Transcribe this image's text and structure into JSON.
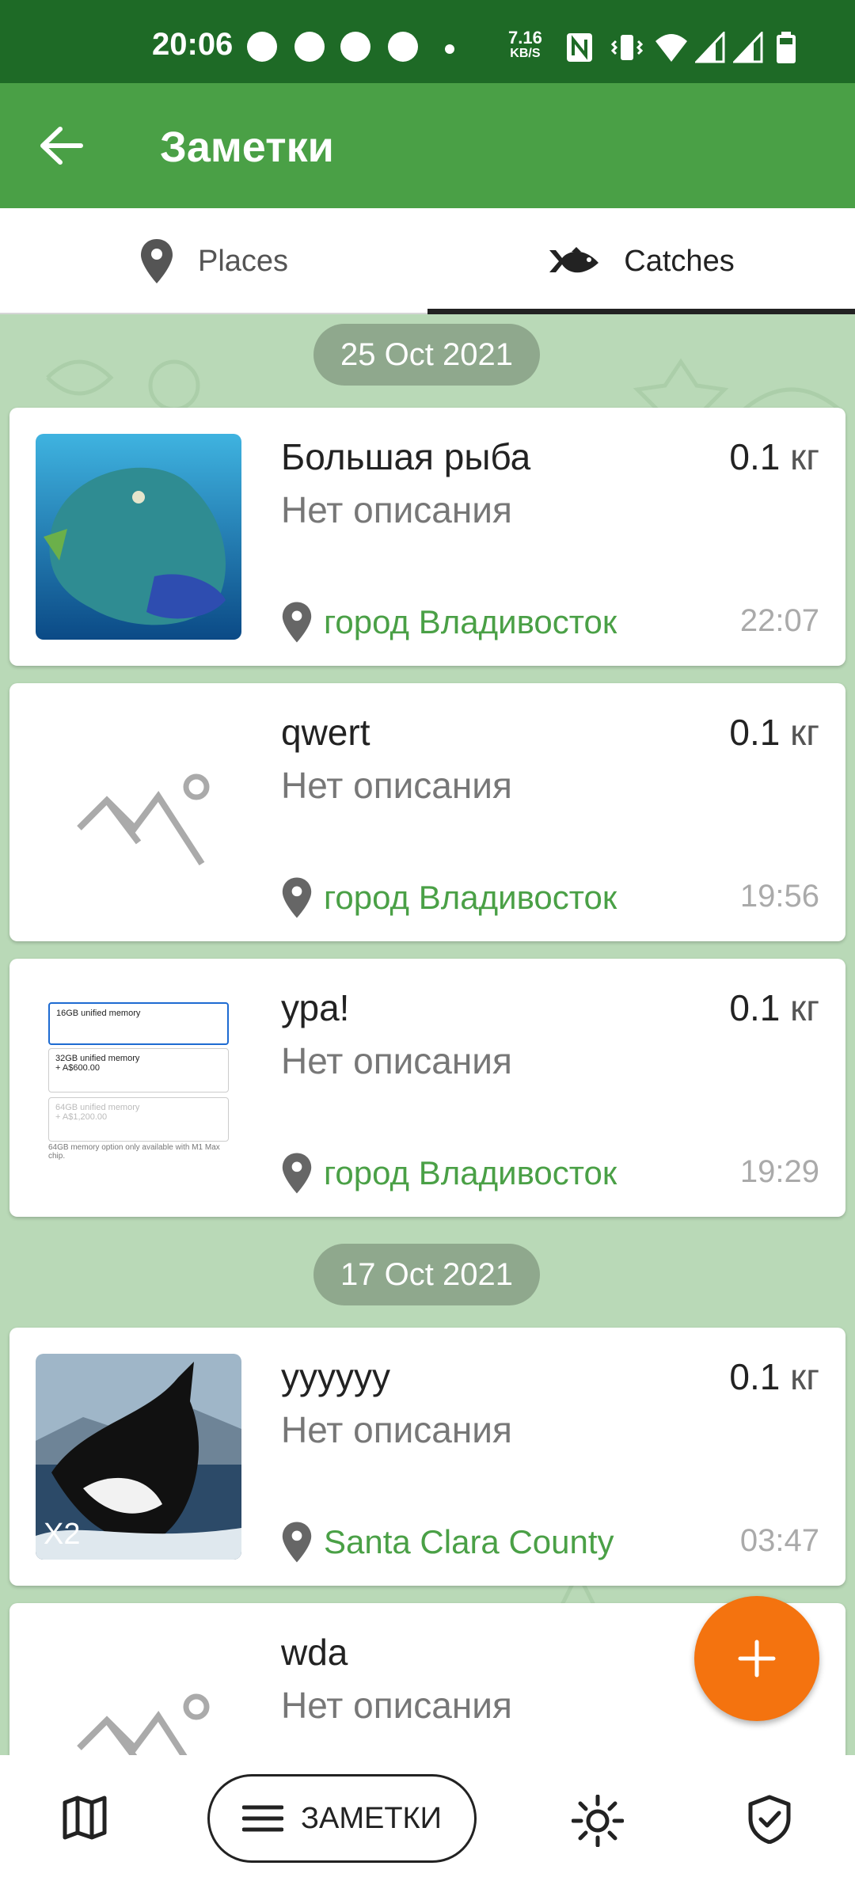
{
  "status_bar": {
    "time": "20:06",
    "net_speed": "7.16",
    "net_unit": "KB/S",
    "icons": [
      "whatsapp-icon",
      "telegram-icon",
      "telegram-icon",
      "telegram-icon",
      "dot",
      "nfc-icon",
      "vibrate-icon",
      "wifi-icon",
      "signal-icon",
      "signal-icon",
      "battery-icon"
    ]
  },
  "app_bar": {
    "title": "Заметки",
    "back_icon": "arrow-left-icon"
  },
  "tabs": [
    {
      "label": "Places",
      "icon": "map-pin-icon",
      "selected": false
    },
    {
      "label": "Catches",
      "icon": "fish-icon",
      "selected": true
    }
  ],
  "sections": [
    {
      "date": "25 Oct 2021",
      "items": [
        {
          "name": "Большая рыба",
          "weight": "0.1",
          "unit": "кг",
          "description": "Нет описания",
          "place": "город Владивосток",
          "time": "22:07",
          "image": "fish-photo"
        },
        {
          "name": "qwert",
          "weight": "0.1",
          "unit": "кг",
          "description": "Нет описания",
          "place": "город Владивосток",
          "time": "19:56",
          "image": "placeholder"
        },
        {
          "name": "ура!",
          "weight": "0.1",
          "unit": "кг",
          "description": "Нет описания",
          "place": "город Владивосток",
          "time": "19:29",
          "image": "screenshot"
        }
      ]
    },
    {
      "date": "17 Oct 2021",
      "items": [
        {
          "name": "уууууу",
          "weight": "0.1",
          "unit": "кг",
          "description": "Нет описания",
          "place": "Santa Clara County",
          "time": "03:47",
          "image": "orca-photo",
          "badge": "X2"
        },
        {
          "name": "wda",
          "description": "Нет описания",
          "image": "placeholder"
        }
      ]
    }
  ],
  "memory_screenshot": {
    "options": [
      {
        "label": "16GB unified memory",
        "price": ""
      },
      {
        "label": "32GB unified memory",
        "price": "+ A$600.00"
      },
      {
        "label": "64GB unified memory",
        "price": "+ A$1,200.00"
      }
    ],
    "note": "64GB memory option only available with M1 Max chip."
  },
  "fab": {
    "icon": "plus-icon"
  },
  "bottom_nav": {
    "items": [
      "map-icon",
      "notes",
      "sun-icon",
      "shield-check-icon"
    ],
    "notes_label": "ЗАМЕТКИ"
  },
  "colors": {
    "status_bar": "#1e6a26",
    "app_bar": "#4aa046",
    "accent_text": "#4aa046",
    "fab": "#f4730f",
    "background": "#b9d9b7"
  }
}
